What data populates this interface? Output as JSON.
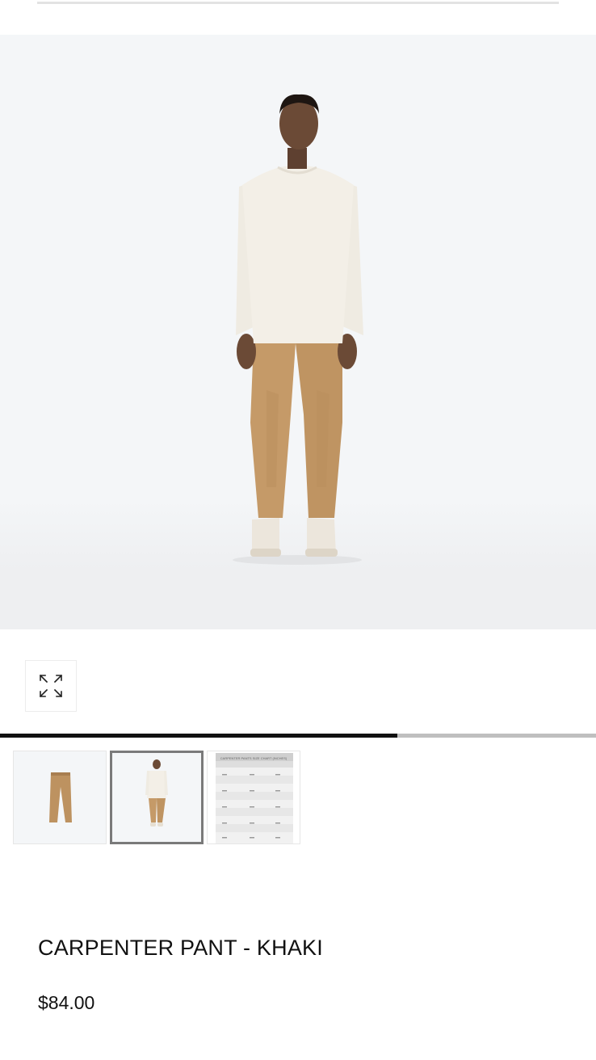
{
  "product": {
    "title": "CARPENTER PANT - KHAKI",
    "price": "$84.00"
  },
  "gallery": {
    "main_image": "model-front-view",
    "expand_icon": "expand-arrows-icon",
    "progress_fraction": 0.667,
    "thumbnails": [
      {
        "name": "thumbnail-pant-flat",
        "active": false
      },
      {
        "name": "thumbnail-model-front",
        "active": true
      },
      {
        "name": "thumbnail-size-chart",
        "active": false,
        "caption": "CARPENTER PANTS SIZE CHART (INCHES)"
      }
    ]
  },
  "colors": {
    "khaki": "#c59a68",
    "shirt": "#f1ede4",
    "hero_bg": "#f4f6f8",
    "progress_fill": "#111111",
    "progress_track": "#bfbfbf"
  }
}
